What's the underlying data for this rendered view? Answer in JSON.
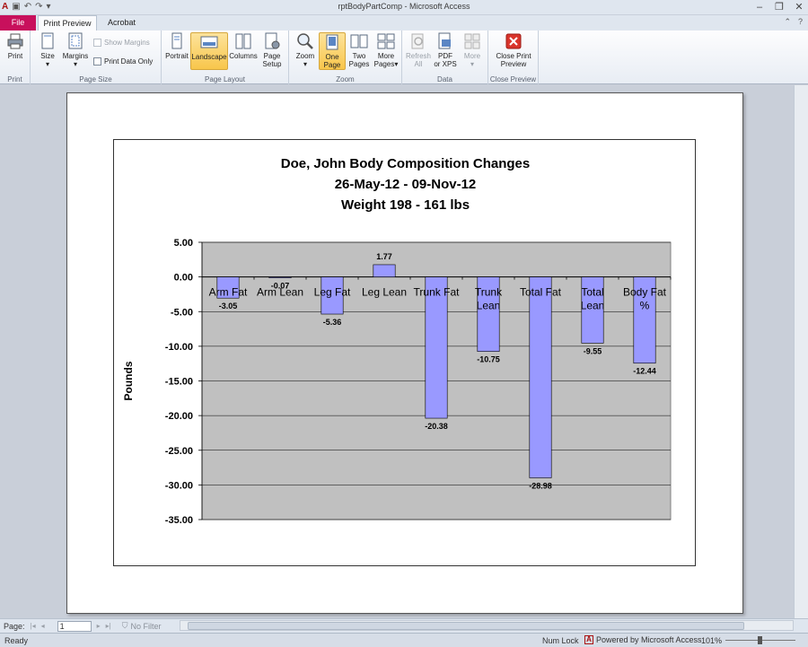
{
  "window": {
    "title": "rptBodyPartComp  -  Microsoft Access"
  },
  "tabs": [
    {
      "label": "File"
    },
    {
      "label": "Print Preview"
    },
    {
      "label": "Acrobat"
    }
  ],
  "ribbon": {
    "groups": {
      "print": "Print",
      "page_size": "Page Size",
      "page_layout": "Page Layout",
      "zoom": "Zoom",
      "data": "Data",
      "close": "Close Preview"
    },
    "buttons": {
      "print": "Print",
      "size": "Size",
      "margins": "Margins",
      "show_margins": "Show Margins",
      "print_data_only": "Print Data Only",
      "portrait": "Portrait",
      "landscape": "Landscape",
      "columns": "Columns",
      "page_setup_1": "Page",
      "page_setup_2": "Setup",
      "zoom": "Zoom",
      "one_page_1": "One",
      "one_page_2": "Page",
      "two_pages_1": "Two",
      "two_pages_2": "Pages",
      "more_pages_1": "More",
      "more_pages_2": "Pages",
      "refresh_1": "Refresh",
      "refresh_2": "All",
      "pdf_1": "PDF",
      "pdf_2": "or XPS",
      "more": "More",
      "close_1": "Close Print",
      "close_2": "Preview"
    }
  },
  "report": {
    "title_line1": "Doe, John Body Composition Changes",
    "title_line2": "26-May-12  -  09-Nov-12",
    "title_line3": "Weight 198  -  161  lbs"
  },
  "chart_data": {
    "type": "bar",
    "title": "",
    "xlabel": "",
    "ylabel": "Pounds",
    "ylim": [
      -35,
      5
    ],
    "yticks": [
      "5.00",
      "0.00",
      "-5.00",
      "-10.00",
      "-15.00",
      "-20.00",
      "-25.00",
      "-30.00",
      "-35.00"
    ],
    "categories": [
      [
        "Arm Fat"
      ],
      [
        "Arm Lean"
      ],
      [
        "Leg Fat"
      ],
      [
        "Leg Lean"
      ],
      [
        "Trunk Fat"
      ],
      [
        "Trunk",
        "Lean"
      ],
      [
        "Total Fat"
      ],
      [
        "Total",
        "Lean"
      ],
      [
        "Body Fat",
        "%"
      ]
    ],
    "values": [
      -3.05,
      -0.07,
      -5.36,
      1.77,
      -20.38,
      -10.75,
      -28.98,
      -9.55,
      -12.44
    ],
    "value_labels": [
      "-3.05",
      "-0.07",
      "-5.36",
      "1.77",
      "-20.38",
      "-10.75",
      "-28.98",
      "-9.55",
      "-12.44"
    ],
    "grid": true,
    "legend": "none",
    "colors": {
      "bar": "#9999ff",
      "plot_bg": "#c0c0c0"
    }
  },
  "navbar": {
    "page_label": "Page:",
    "page_value": "1",
    "filter": "No Filter"
  },
  "status": {
    "ready": "Ready",
    "numlock": "Num Lock",
    "powered": "Powered by Microsoft Access",
    "zoom": "101%"
  }
}
